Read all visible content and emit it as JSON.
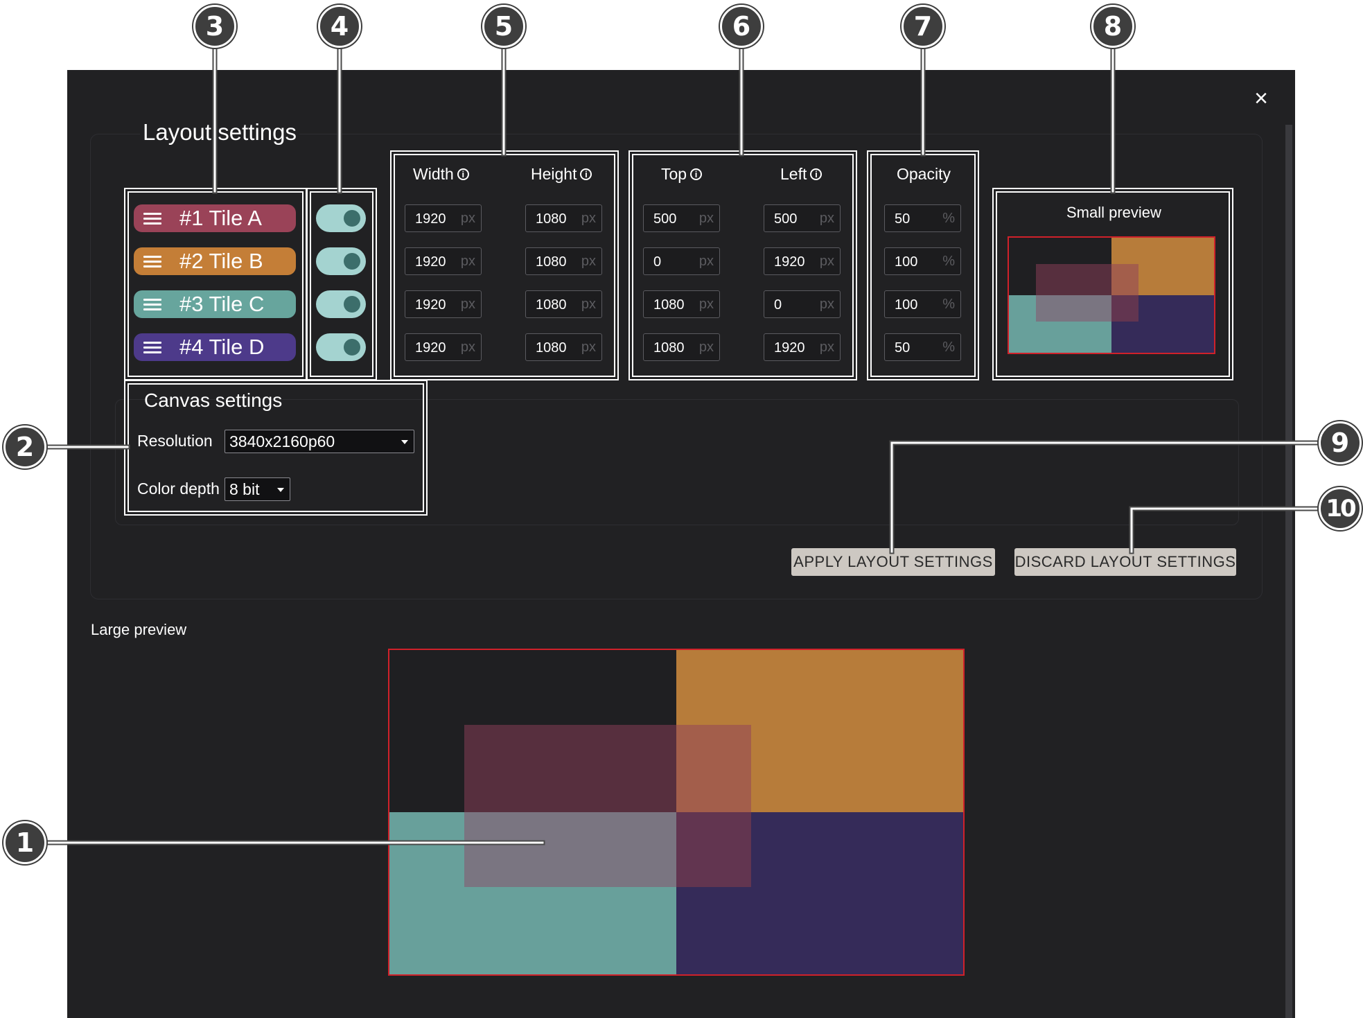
{
  "dialog": {
    "title": "Layout settings",
    "close_label": "×"
  },
  "tiles": [
    {
      "label": "#1  Tile A",
      "color": "#9a4358",
      "enabled": true,
      "width": "1920",
      "height": "1080",
      "top": "500",
      "left": "500",
      "opacity": "50"
    },
    {
      "label": "#2  Tile B",
      "color": "#c47e37",
      "enabled": true,
      "width": "1920",
      "height": "1080",
      "top": "0",
      "left": "1920",
      "opacity": "100"
    },
    {
      "label": "#3  Tile C",
      "color": "#67a59d",
      "enabled": true,
      "width": "1920",
      "height": "1080",
      "top": "1080",
      "left": "0",
      "opacity": "100"
    },
    {
      "label": "#4  Tile D",
      "color": "#4d3a8a",
      "enabled": true,
      "width": "1920",
      "height": "1080",
      "top": "1080",
      "left": "1920",
      "opacity": "50"
    }
  ],
  "columns": {
    "width": "Width",
    "height": "Height",
    "top": "Top",
    "left": "Left",
    "opacity": "Opacity"
  },
  "units": {
    "px": "px",
    "percent": "%"
  },
  "small_preview": {
    "title": "Small preview"
  },
  "canvas": {
    "title": "Canvas settings",
    "resolution_label": "Resolution",
    "resolution_value": "3840x2160p60",
    "color_depth_label": "Color depth",
    "color_depth_value": "8 bit",
    "width": 3840,
    "height": 2160
  },
  "buttons": {
    "apply": "APPLY LAYOUT SETTINGS",
    "discard": "DISCARD LAYOUT SETTINGS"
  },
  "large_preview": {
    "title": "Large preview"
  },
  "preview_colors": {
    "tile_a": "#572f3e",
    "tile_b": "#b77c3a",
    "tile_c": "#68a09b",
    "tile_d": "#352b59",
    "overlap_ab": "#a35e4b",
    "overlap_ac": "#7a7581",
    "overlap_ad": "#623550",
    "border": "#d0212a"
  },
  "callouts": [
    "3",
    "4",
    "5",
    "6",
    "7",
    "8",
    "2",
    "9",
    "10",
    "1"
  ]
}
